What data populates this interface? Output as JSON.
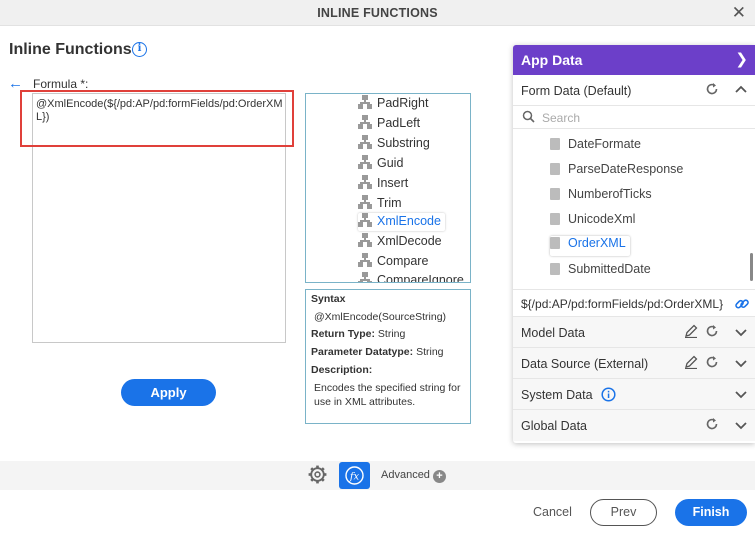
{
  "window": {
    "title": "INLINE FUNCTIONS",
    "close_label": "✕"
  },
  "page": {
    "heading": "Inline Functions",
    "formula_label": "Formula *:"
  },
  "formula": {
    "value": "@XmlEncode(${/pd:AP/pd:formFields/pd:OrderXML})"
  },
  "apply_label": "Apply",
  "functions": [
    "PadRight",
    "PadLeft",
    "Substring",
    "Guid",
    "Insert",
    "Trim",
    "XmlEncode",
    "XmlDecode",
    "Compare",
    "CompareIgnore…"
  ],
  "selected_function": "XmlEncode",
  "syntax": {
    "title": "Syntax",
    "signature": "@XmlEncode(SourceString)",
    "return_type_label": "Return Type:",
    "return_type": "String",
    "param_label": "Parameter Datatype:",
    "param_type": "String",
    "desc_label": "Description:",
    "description": "Encodes the specified string for use in XML attributes."
  },
  "app_data": {
    "title": "App Data",
    "form_data_label": "Form Data (Default)",
    "search_placeholder": "Search",
    "items": [
      "DateFormate",
      "ParseDateResponse",
      "NumberofTicks",
      "UnicodeXml",
      "OrderXML",
      "SubmittedDate"
    ],
    "selected_item": "OrderXML",
    "path": "${/pd:AP/pd:formFields/pd:OrderXML}",
    "sections": [
      "Model Data",
      "Data Source (External)",
      "System Data",
      "Global Data"
    ]
  },
  "footer": {
    "advanced_label": "Advanced",
    "cancel_label": "Cancel",
    "prev_label": "Prev",
    "finish_label": "Finish"
  },
  "colors": {
    "accent": "#1a73e8",
    "panel_header": "#6c3fc9",
    "highlight": "#e0403a"
  }
}
